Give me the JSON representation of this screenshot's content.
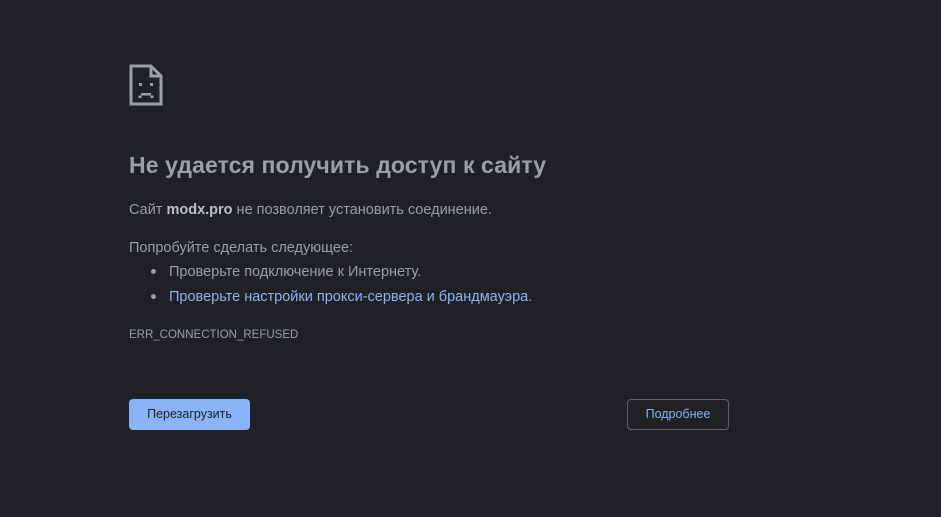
{
  "icon": "sad-page-icon",
  "headline": "Не удается получить доступ к сайту",
  "summary": {
    "prefix": "Сайт ",
    "host": "modx.pro",
    "suffix": " не позволяет установить соединение."
  },
  "suggestions": {
    "heading": "Попробуйте сделать следующее:",
    "items": [
      {
        "text": "Проверьте подключение к Интернету.",
        "link": "",
        "after": ""
      },
      {
        "text": "",
        "link": "Проверьте настройки прокси-сервера и брандмауэра",
        "after": "."
      }
    ]
  },
  "error_code": "ERR_CONNECTION_REFUSED",
  "buttons": {
    "reload": "Перезагрузить",
    "details": "Подробнее"
  },
  "colors": {
    "background": "#202124",
    "text": "#9aa0a6",
    "accent": "#8ab4f8"
  }
}
